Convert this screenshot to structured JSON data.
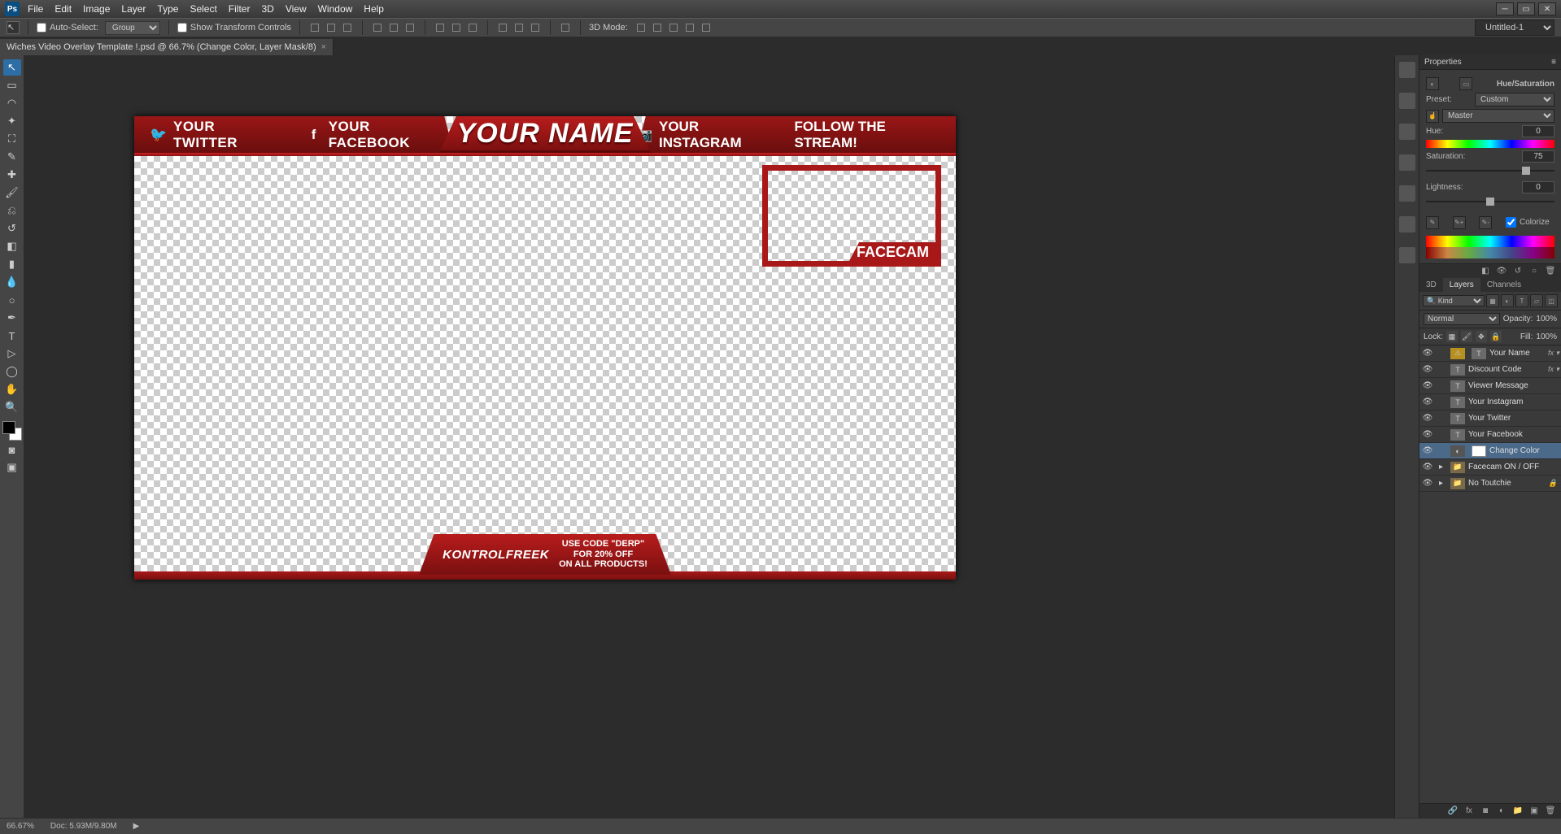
{
  "titlebar": {
    "logo": "Ps"
  },
  "menu": [
    "File",
    "Edit",
    "Image",
    "Layer",
    "Type",
    "Select",
    "Filter",
    "3D",
    "View",
    "Window",
    "Help"
  ],
  "options": {
    "auto_select": "Auto-Select:",
    "group": "Group",
    "show_transform": "Show Transform Controls",
    "mode3d": "3D Mode:"
  },
  "workspace": "Untitled-1",
  "tab": {
    "title": "Wiches Video Overlay Template !.psd @ 66.7% (Change Color, Layer Mask/8)"
  },
  "overlay": {
    "twitter": "YOUR TWITTER",
    "facebook": "YOUR FACEBOOK",
    "name": "YOUR  NAME",
    "instagram": "YOUR INSTAGRAM",
    "follow": "FOLLOW THE STREAM!",
    "facecam": "FACECAM",
    "sponsor": "KONTROLFREEK",
    "promo1": "USE CODE \"DERP\"",
    "promo2": "FOR 20% OFF",
    "promo3": "ON ALL PRODUCTS!"
  },
  "properties": {
    "title": "Properties",
    "adj_name": "Hue/Saturation",
    "preset_label": "Preset:",
    "preset_value": "Custom",
    "channel": "Master",
    "hue_label": "Hue:",
    "hue_value": "0",
    "sat_label": "Saturation:",
    "sat_value": "75",
    "light_label": "Lightness:",
    "light_value": "0",
    "colorize": "Colorize"
  },
  "layers": {
    "tab_3d": "3D",
    "tab_layers": "Layers",
    "tab_channels": "Channels",
    "kind": "Kind",
    "blend": "Normal",
    "opacity_label": "Opacity:",
    "opacity": "100%",
    "lock_label": "Lock:",
    "fill_label": "Fill:",
    "fill": "100%",
    "items": [
      {
        "name": "Your Name",
        "type": "T",
        "fx": true,
        "warn": true
      },
      {
        "name": "Discount Code",
        "type": "T",
        "fx": true
      },
      {
        "name": "Viewer Message",
        "type": "T"
      },
      {
        "name": "Your Instagram",
        "type": "T"
      },
      {
        "name": "Your Twitter",
        "type": "T"
      },
      {
        "name": "Your Facebook",
        "type": "T"
      },
      {
        "name": "Change Color",
        "type": "ADJ",
        "selected": true,
        "mask": true
      },
      {
        "name": "Facecam ON / OFF",
        "type": "GRP",
        "arrow": true
      },
      {
        "name": "No Toutchie",
        "type": "GRP",
        "arrow": true,
        "lock": true
      }
    ]
  },
  "status": {
    "zoom": "66.67%",
    "doc": "Doc: 5.93M/9.80M"
  }
}
